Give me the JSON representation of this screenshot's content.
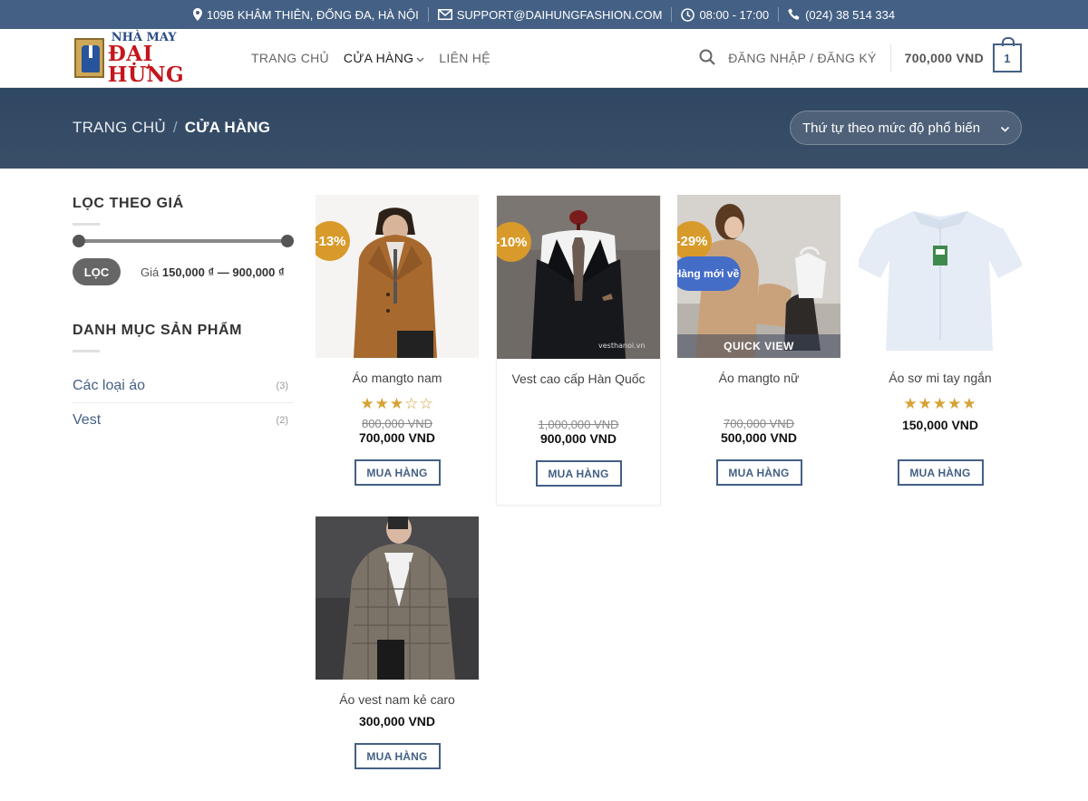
{
  "topbar": {
    "address": "109B KHÂM THIÊN, ĐỐNG ĐA, HÀ NỘI",
    "email": "SUPPORT@DAIHUNGFASHION.COM",
    "hours": "08:00 - 17:00",
    "phone": "(024) 38 514 334"
  },
  "header": {
    "logo_line1": "NHÀ MAY",
    "logo_line2": "ĐẠI HƯNG",
    "nav": [
      "TRANG CHỦ",
      "CỬA HÀNG",
      "LIÊN HỆ"
    ],
    "login": "ĐĂNG NHẬP / ĐĂNG KÝ",
    "cart_total": "700,000 VND",
    "cart_count": "1"
  },
  "banner": {
    "crumb_home": "TRANG CHỦ",
    "crumb_sep": "/",
    "crumb_current": "CỬA HÀNG",
    "sort_selected": "Thứ tự theo mức độ phổ biến"
  },
  "sidebar": {
    "price_filter_title": "LỌC THEO GIÁ",
    "filter_button": "LỌC",
    "price_label": "Giá",
    "price_min": "150,000 ₫",
    "price_dash": "—",
    "price_max": "900,000 ₫",
    "categories_title": "DANH MỤC SẢN PHẨM",
    "categories": [
      {
        "label": "Các loại áo",
        "count": "(3)"
      },
      {
        "label": "Vest",
        "count": "(2)"
      }
    ]
  },
  "products": [
    {
      "name": "Áo mangto nam",
      "sale": "-13%",
      "rating": 3,
      "old_price": "800,000 VND",
      "price": "700,000 VND",
      "button": "MUA HÀNG"
    },
    {
      "name": "Vest cao cấp Hàn Quốc",
      "sale": "-10%",
      "old_price": "1,000,000 VND",
      "price": "900,000 VND",
      "button": "MUA HÀNG"
    },
    {
      "name": "Áo mangto nữ",
      "sale": "-29%",
      "new_badge": "Hàng mới về",
      "quick_view": "QUICK VIEW",
      "old_price": "700,000 VND",
      "price": "500,000 VND",
      "button": "MUA HÀNG"
    },
    {
      "name": "Áo sơ mi tay ngắn",
      "rating": 5,
      "price": "150,000 VND",
      "button": "MUA HÀNG"
    },
    {
      "name": "Áo vest nam kẻ caro",
      "price": "300,000 VND",
      "button": "MUA HÀNG"
    }
  ],
  "colors": {
    "primary": "#446084",
    "topbar": "#446084",
    "sale_badge": "#d89a2a",
    "new_badge": "#446dc7",
    "star": "#d6a236"
  }
}
